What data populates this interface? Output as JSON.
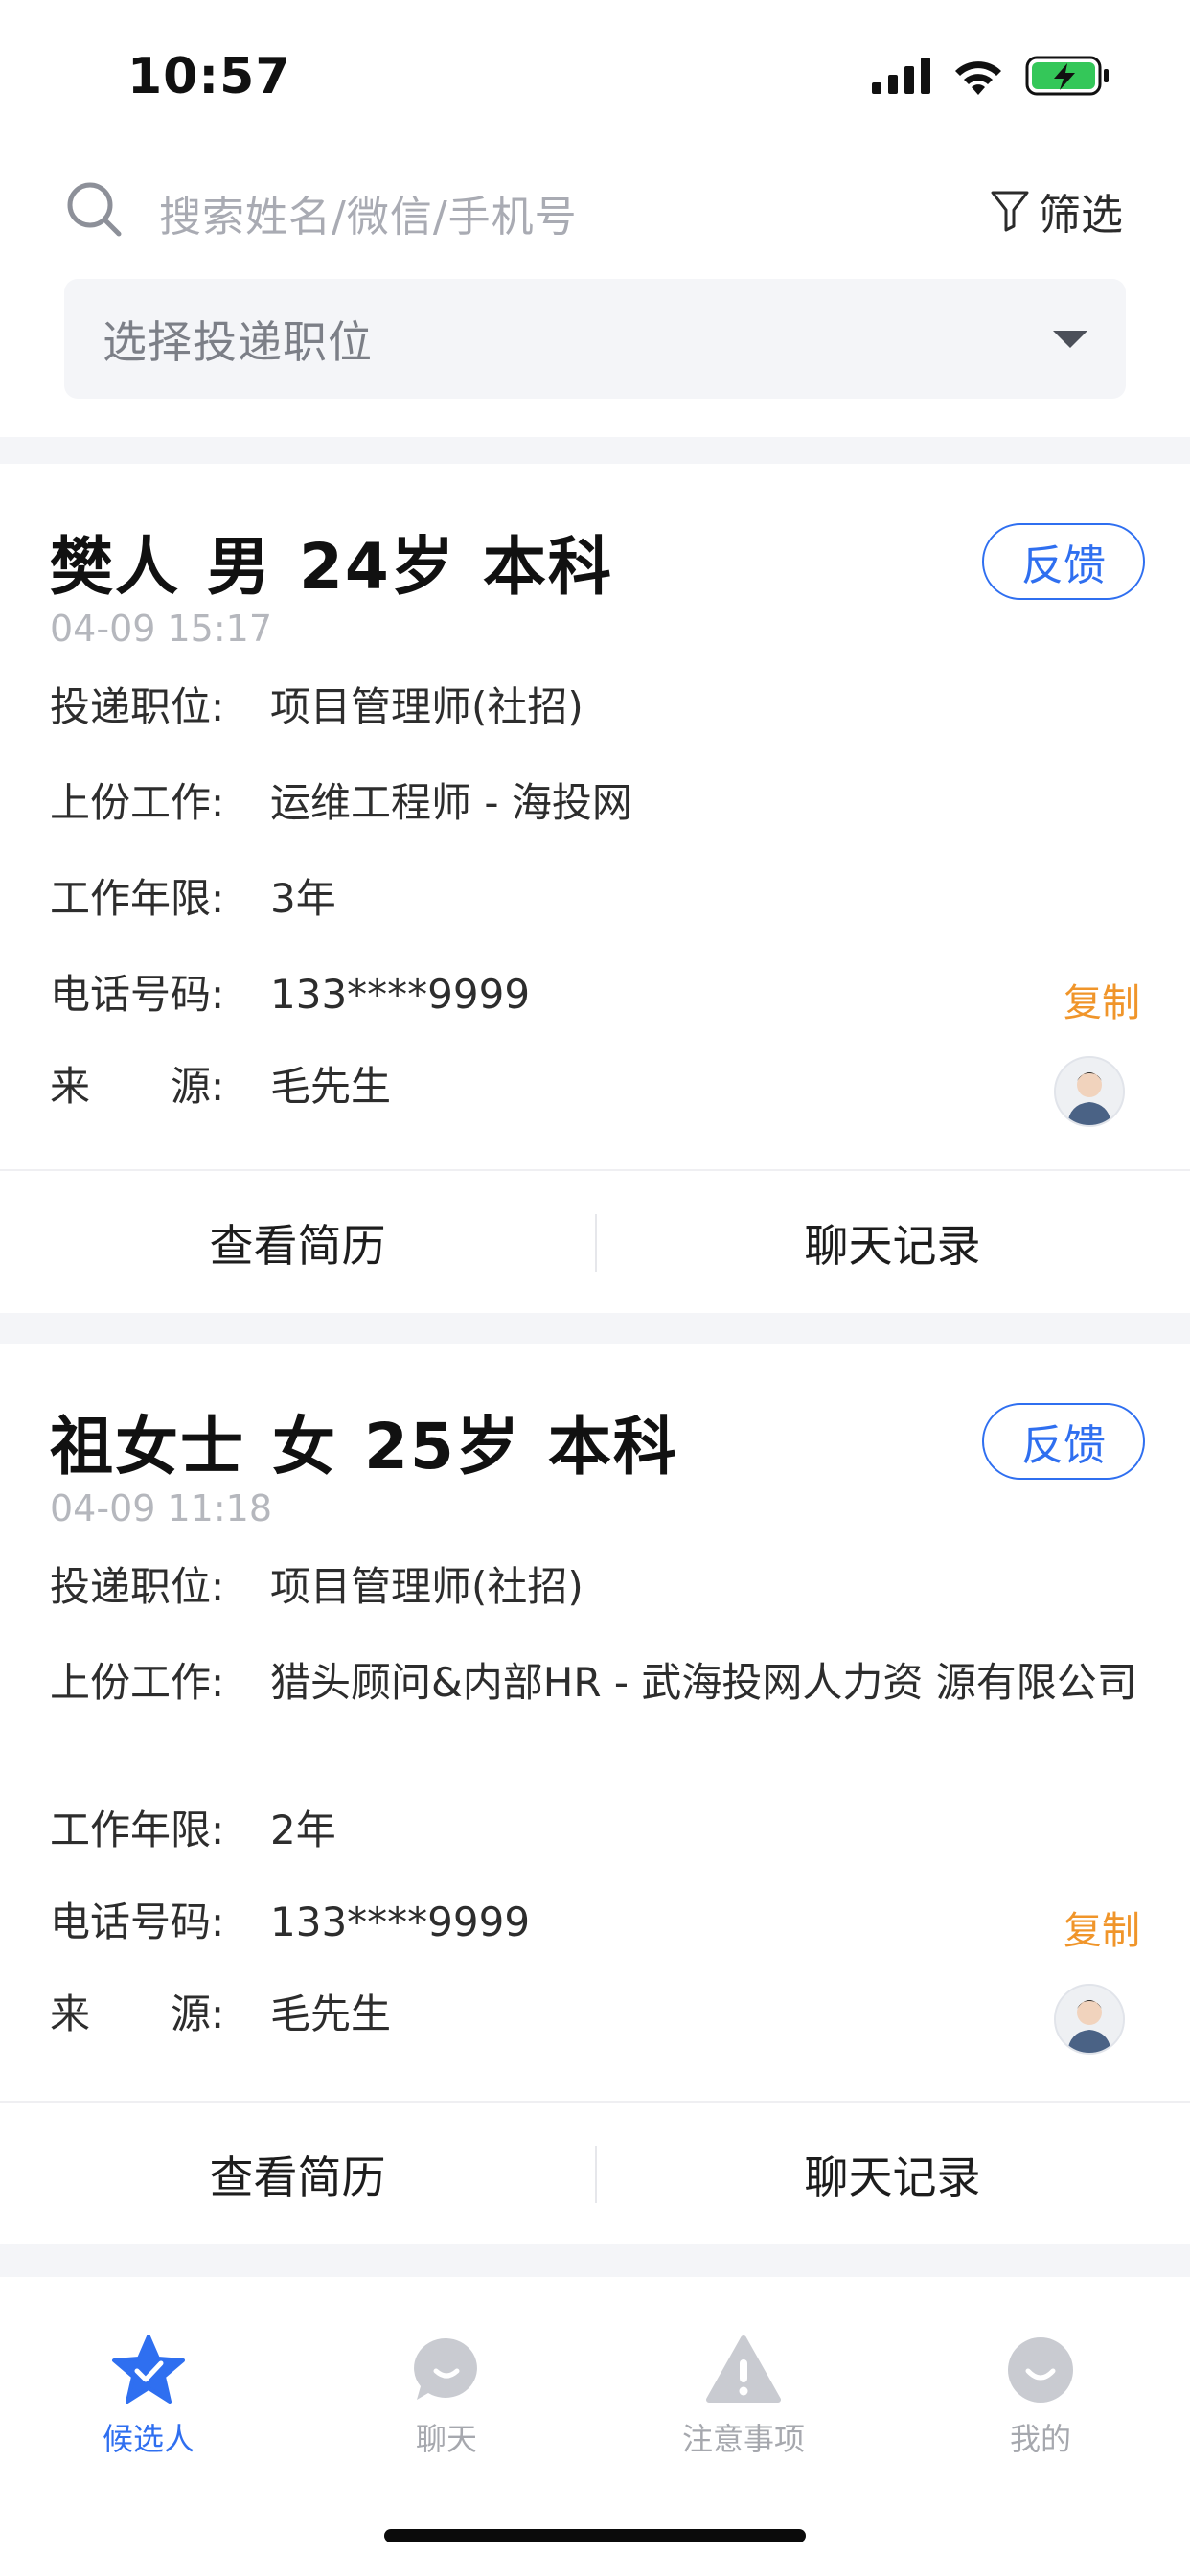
{
  "status_bar": {
    "time": "10:57"
  },
  "search": {
    "placeholder": "搜索姓名/微信/手机号",
    "filter_label": "筛选"
  },
  "position_select": {
    "placeholder": "选择投递职位"
  },
  "labels": {
    "position": "投递职位:",
    "last_job": "上份工作:",
    "years": "工作年限:",
    "phone": "电话号码:",
    "source": "来　　源:",
    "copy": "复制",
    "feedback": "反馈",
    "view_resume": "查看简历",
    "chat_history": "聊天记录"
  },
  "candidates": [
    {
      "name": "樊人",
      "gender": "男",
      "age": "24岁",
      "education": "本科",
      "time": "04-09 15:17",
      "position": "项目管理师(社招)",
      "last_job": "运维工程师 - 海投网",
      "years": "3年",
      "phone": "133****9999",
      "source": "毛先生"
    },
    {
      "name": "祖女士",
      "gender": "女",
      "age": "25岁",
      "education": "本科",
      "time": "04-09 11:18",
      "position": "项目管理师(社招)",
      "last_job": "猎头顾问&内部HR - 武海投网人力资 源有限公司",
      "years": "2年",
      "phone": "133****9999",
      "source": "毛先生"
    }
  ],
  "tabs": [
    {
      "label": "候选人",
      "icon": "star-check-icon",
      "active": true
    },
    {
      "label": "聊天",
      "icon": "chat-bubble-icon",
      "active": false
    },
    {
      "label": "注意事项",
      "icon": "warning-icon",
      "active": false
    },
    {
      "label": "我的",
      "icon": "profile-smile-icon",
      "active": false
    }
  ],
  "colors": {
    "accent": "#2f6ff0",
    "copy": "#f0952a",
    "background_band": "#f4f5f8"
  }
}
